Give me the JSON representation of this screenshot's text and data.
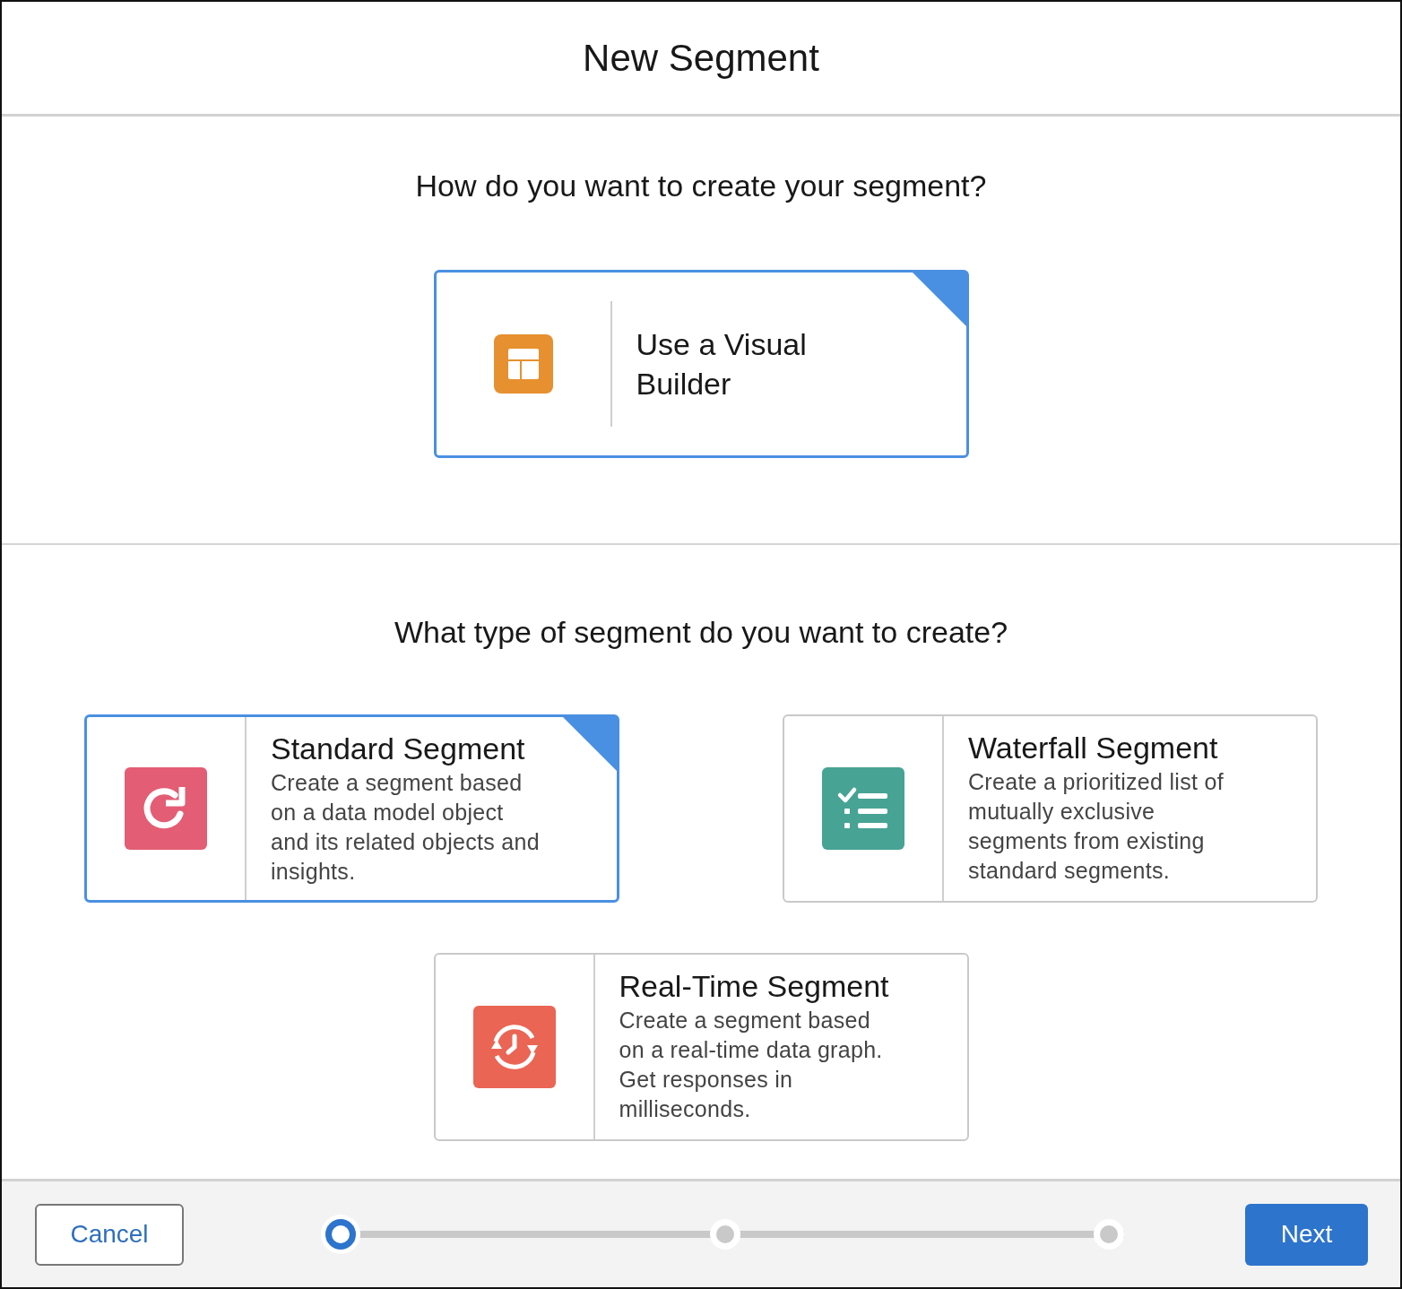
{
  "modal": {
    "title": "New Segment"
  },
  "method_section": {
    "question": "How do you want to create your segment?",
    "options": [
      {
        "kind": "builder",
        "title": "Use a Visual Builder",
        "selected": true
      }
    ]
  },
  "type_section": {
    "question": "What type of segment do you want to create?",
    "options": [
      {
        "kind": "standard",
        "title": "Standard Segment",
        "description": "Create a segment based on a data model object and its related objects and insights.",
        "selected": true
      },
      {
        "kind": "waterfall",
        "title": "Waterfall Segment",
        "description": "Create a prioritized list of mutually exclusive segments from existing standard segments.",
        "selected": false
      },
      {
        "kind": "realtime",
        "title": "Real-Time Segment",
        "description": "Create a segment based on a real-time data graph. Get responses in milliseconds.",
        "selected": false
      }
    ]
  },
  "footer": {
    "cancel": "Cancel",
    "next": "Next",
    "steps": [
      {
        "selected": true
      },
      {
        "selected": false
      },
      {
        "selected": false
      }
    ]
  }
}
